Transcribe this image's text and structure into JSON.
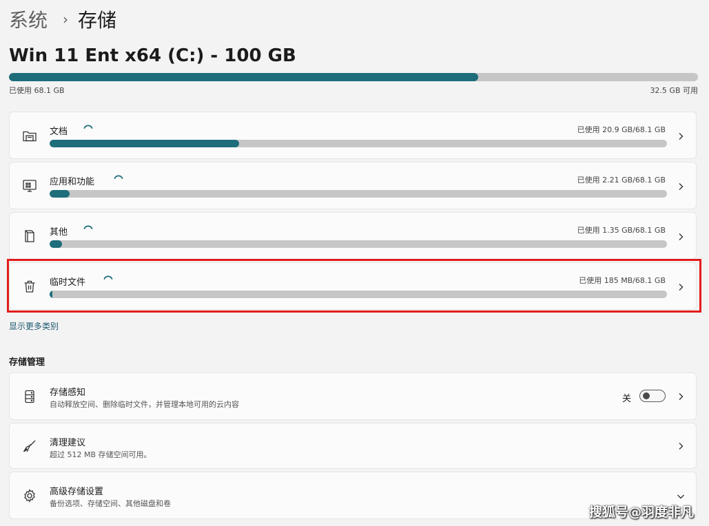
{
  "breadcrumb": {
    "parent": "系统",
    "separator": "›",
    "current": "存储"
  },
  "drive": {
    "title": "Win 11 Ent x64 (C:) - 100 GB",
    "used_text": "已使用 68.1 GB",
    "free_text": "32.5 GB 可用",
    "used_fraction": 0.681
  },
  "categories": [
    {
      "label": "文档",
      "used_text": "已使用 20.9 GB/68.1 GB",
      "fraction": 0.307,
      "icon": "folder-icon"
    },
    {
      "label": "应用和功能",
      "used_text": "已使用 2.21 GB/68.1 GB",
      "fraction": 0.032,
      "icon": "apps-icon"
    },
    {
      "label": "其他",
      "used_text": "已使用 1.35 GB/68.1 GB",
      "fraction": 0.02,
      "icon": "other-icon"
    },
    {
      "label": "临时文件",
      "used_text": "已使用 185 MB/68.1 GB",
      "fraction": 0.003,
      "icon": "trash-icon"
    }
  ],
  "show_more": "显示更多类别",
  "section_title": "存储管理",
  "management": [
    {
      "title": "存储感知",
      "subtitle": "自动释放空间、删除临时文件，并管理本地可用的云内容",
      "toggle_label": "关",
      "toggle_on": false,
      "icon": "storage-sense-icon"
    },
    {
      "title": "清理建议",
      "subtitle": "超过 512 MB 存储空间可用。",
      "icon": "broom-icon"
    },
    {
      "title": "高级存储设置",
      "subtitle": "备份选项、存储空间、其他磁盘和卷",
      "icon": "gear-icon"
    }
  ],
  "watermark": "搜狐号@羽度非凡",
  "colors": {
    "accent": "#1e6d7b",
    "bar_track": "#c6c6c6",
    "highlight": "#e31c1c",
    "link": "#1e5a70"
  }
}
